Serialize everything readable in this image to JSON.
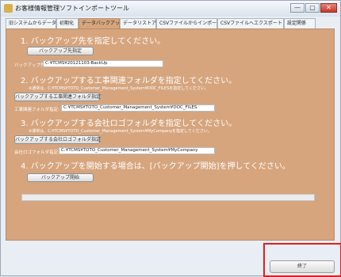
{
  "window": {
    "title": "お客様情報管理ソフトインポートツール",
    "controls": [
      "—",
      "▢",
      "✕"
    ]
  },
  "tabs": [
    {
      "label": "旧システムからデータ移行"
    },
    {
      "label": "初期化"
    },
    {
      "label": "データバックアップ",
      "active": true
    },
    {
      "label": "データリストア"
    },
    {
      "label": "CSVファイルからインポート"
    },
    {
      "label": "CSVファイルへエクスポート"
    },
    {
      "label": "設定関係"
    }
  ],
  "sections": {
    "backup_dest": {
      "heading": "1. バックアップ先を指定してください。",
      "button": "バックアップ先指定",
      "field_label": "バックアップ先:",
      "field_value": "C:¥TCMS¥20121103-BackUp"
    },
    "construction_folder": {
      "heading": "2. バックアップする工事関連フォルダを指定してください。",
      "note": "※通常は、C:¥TCMS¥TOTO_Customer_Management_System¥DOC_FILESを指定してください。",
      "button": "バックアップする工事関連フォルダ指定",
      "field_label": "工事関連フォルダ指定:",
      "field_value": "C:¥TCMS¥TOTO_Customer_Management_System¥DOC_FILES"
    },
    "logo_folder": {
      "heading": "3. バックアップする会社ロゴフォルダを指定してください。",
      "note": "※通常は、C:¥TCMS¥TOTO_Customer_Management_System¥MyCompanyを指定してください。",
      "button": "バックアップする会社ロゴフォルダ指定",
      "field_label": "会社ロゴフォルダ指定:",
      "field_value": "C:¥TCMS¥TOTO_Customer_Management_System¥MyCompany"
    },
    "start": {
      "heading": "4. バックアップを開始する場合は、[バックアップ開始]を押してください。",
      "button": "バックアップ開始",
      "progress": 0
    }
  },
  "footer": {
    "exit_label": "終了"
  },
  "colors": {
    "panel": "#d6a57e",
    "highlight": "#e01e1e"
  }
}
